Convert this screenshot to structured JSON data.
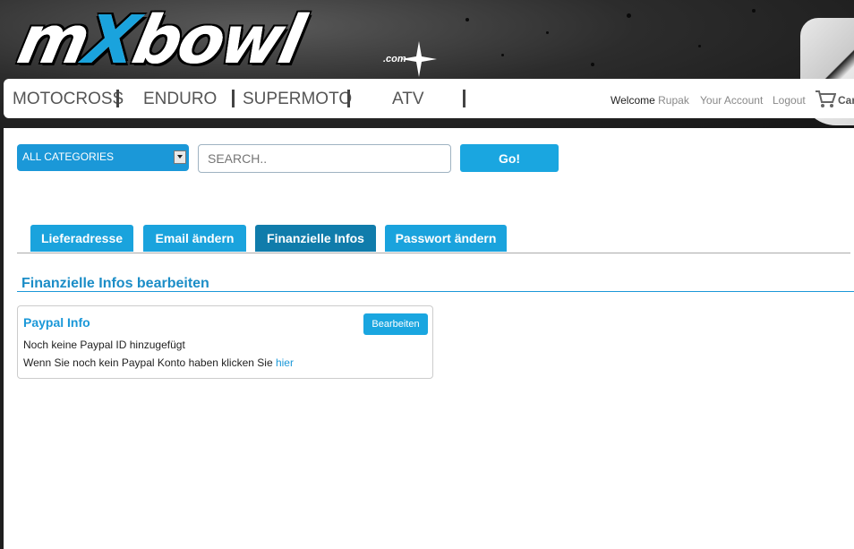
{
  "logo": {
    "main": "mXbowl",
    "letters_before": "m",
    "x_letter": "X",
    "letters_after": "bowl",
    "suffix": ".com"
  },
  "nav": {
    "items": [
      "MOTOCROSS",
      "ENDURO",
      "SUPERMOTO",
      "ATV"
    ],
    "welcome_prefix": "Welcome",
    "username": "Rupak",
    "your_account": "Your Account",
    "logout": "Logout",
    "cart": "Car"
  },
  "search": {
    "category": "ALL CATEGORIES",
    "placeholder": "SEARCH..",
    "go_label": "Go!"
  },
  "tabs": [
    {
      "label": "Lieferadresse"
    },
    {
      "label": "Email ändern"
    },
    {
      "label": "Finanzielle Infos",
      "active": true
    },
    {
      "label": "Passwort ändern"
    }
  ],
  "section": {
    "title": "Finanzielle Infos bearbeiten"
  },
  "paypal": {
    "title": "Paypal Info",
    "edit_button": "Bearbeiten",
    "status": "Noch keine Paypal ID hinzugefügt",
    "hint_text": "Wenn Sie noch kein Paypal Konto haben klicken Sie",
    "hint_link": "hier"
  },
  "colors": {
    "accent": "#1aa3dd",
    "active_tab": "#107cab"
  }
}
